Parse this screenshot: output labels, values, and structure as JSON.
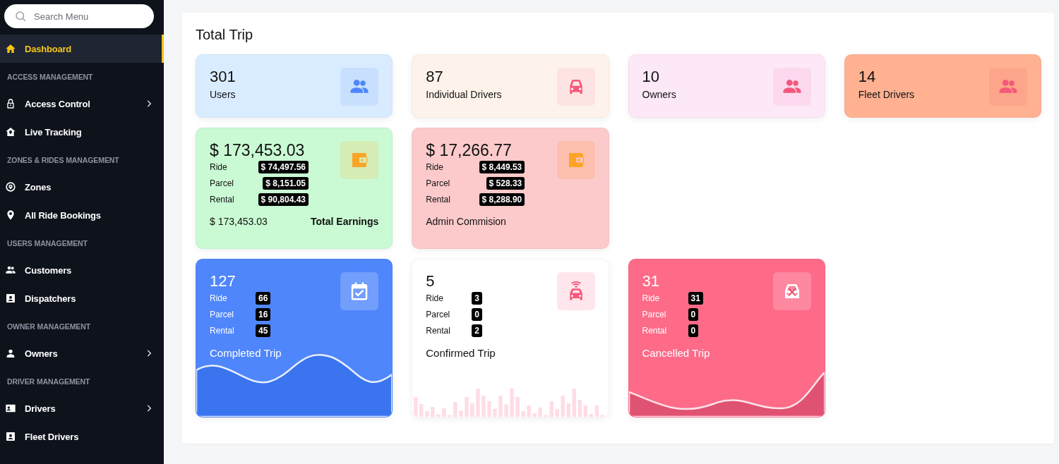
{
  "sidebar": {
    "search": {
      "placeholder": "Search Menu"
    },
    "items": [
      {
        "kind": "item",
        "label": "Dashboard",
        "selected": true,
        "expandable": false
      },
      {
        "kind": "section",
        "label": "ACCESS MANAGEMENT"
      },
      {
        "kind": "item",
        "label": "Access Control",
        "selected": false,
        "expandable": true
      },
      {
        "kind": "item",
        "label": "Live Tracking",
        "selected": false,
        "expandable": false
      },
      {
        "kind": "section",
        "label": "ZONES & RIDES MANAGEMENT"
      },
      {
        "kind": "item",
        "label": "Zones",
        "selected": false,
        "expandable": false
      },
      {
        "kind": "item",
        "label": "All Ride Bookings",
        "selected": false,
        "expandable": false
      },
      {
        "kind": "section",
        "label": "USERS MANAGEMENT"
      },
      {
        "kind": "item",
        "label": "Customers",
        "selected": false,
        "expandable": false
      },
      {
        "kind": "item",
        "label": "Dispatchers",
        "selected": false,
        "expandable": false
      },
      {
        "kind": "section",
        "label": "OWNER MANAGEMENT"
      },
      {
        "kind": "item",
        "label": "Owners",
        "selected": false,
        "expandable": true
      },
      {
        "kind": "section",
        "label": "DRIVER MANAGEMENT"
      },
      {
        "kind": "item",
        "label": "Drivers",
        "selected": false,
        "expandable": true
      },
      {
        "kind": "item",
        "label": "Fleet Drivers",
        "selected": false,
        "expandable": false
      }
    ]
  },
  "main": {
    "title": "Total Trip",
    "rows": [
      [
        {
          "kind": "stat",
          "color": "#d9ecff",
          "value": "301",
          "label": "Users"
        },
        {
          "kind": "stat",
          "color": "#fef3ea",
          "value": "87",
          "label": "Individual Drivers"
        },
        {
          "kind": "stat",
          "color": "#fde8f7",
          "value": "10",
          "label": "Owners"
        },
        {
          "kind": "stat",
          "color": "#ffb192",
          "value": "14",
          "label": "Fleet Drivers"
        }
      ],
      [
        {
          "kind": "earnings",
          "color": "#c9fad3",
          "value": "$ 173,453.03",
          "breakdown": [
            {
              "label": "Ride",
              "value": "$ 74,497.56"
            },
            {
              "label": "Parcel",
              "value": "$ 8,151.05"
            },
            {
              "label": "Rental",
              "value": "$ 90,804.43"
            }
          ],
          "footer_value": "$ 173,453.03",
          "footer_label": "Total Earnings"
        },
        {
          "kind": "earnings",
          "color": "#fdcacb",
          "value": "$ 17,266.77",
          "breakdown": [
            {
              "label": "Ride",
              "value": "$ 8,449.53"
            },
            {
              "label": "Parcel",
              "value": "$ 528.33"
            },
            {
              "label": "Rental",
              "value": "$ 8,288.90"
            }
          ],
          "footer_label": "Admin Commision"
        }
      ],
      [
        {
          "kind": "trip",
          "color": "#4f86fc",
          "value": "127",
          "breakdown": [
            {
              "label": "Ride",
              "value": "66"
            },
            {
              "label": "Parcel",
              "value": "16"
            },
            {
              "label": "Rental",
              "value": "45"
            }
          ],
          "label": "Completed Trip"
        },
        {
          "kind": "trip",
          "color": "#ffffff",
          "value": "5",
          "breakdown": [
            {
              "label": "Ride",
              "value": "3"
            },
            {
              "label": "Parcel",
              "value": "0"
            },
            {
              "label": "Rental",
              "value": "2"
            }
          ],
          "label": "Confirmed Trip"
        },
        {
          "kind": "trip",
          "color": "#fd6b89",
          "value": "31",
          "breakdown": [
            {
              "label": "Ride",
              "value": "31"
            },
            {
              "label": "Parcel",
              "value": "0"
            },
            {
              "label": "Rental",
              "value": "0"
            }
          ],
          "label": "Cancelled Trip"
        }
      ]
    ]
  }
}
